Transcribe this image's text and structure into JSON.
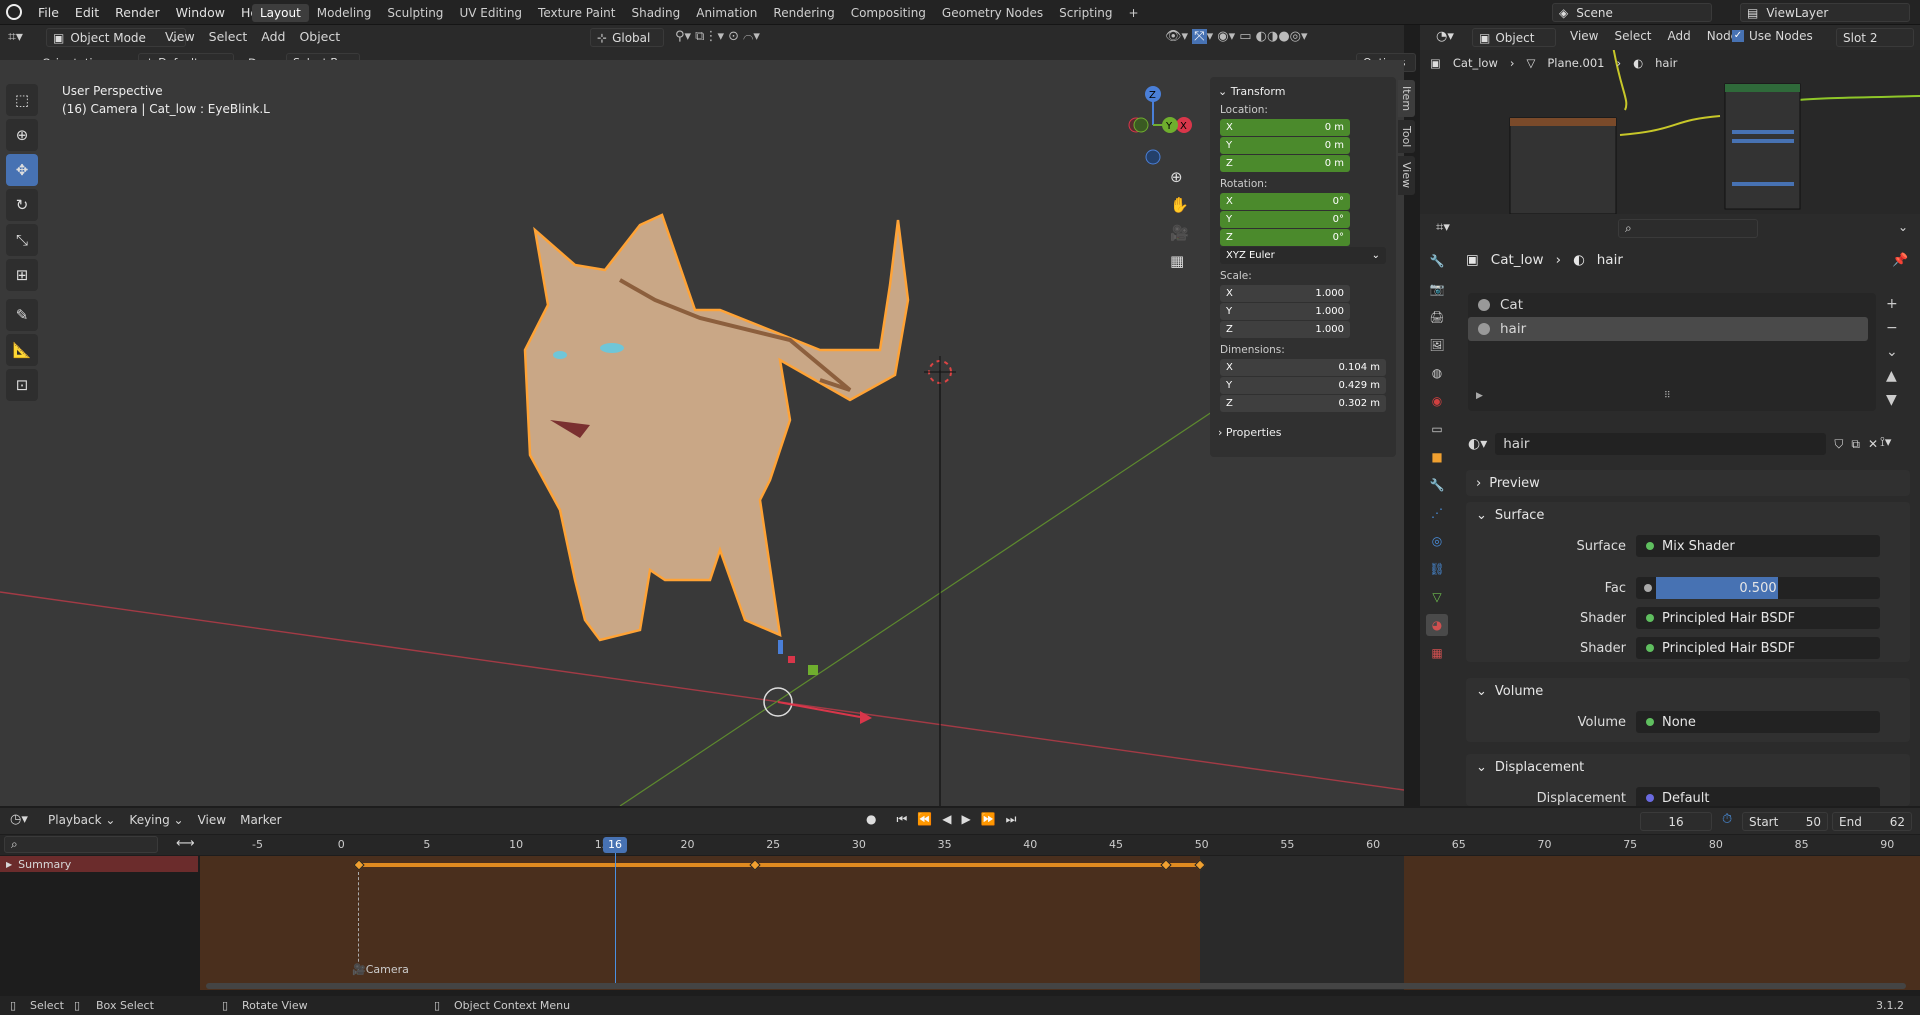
{
  "menubar": {
    "items": [
      "File",
      "Edit",
      "Render",
      "Window",
      "Help"
    ]
  },
  "workspaces": [
    "Layout",
    "Modeling",
    "Sculpting",
    "UV Editing",
    "Texture Paint",
    "Shading",
    "Animation",
    "Rendering",
    "Compositing",
    "Geometry Nodes",
    "Scripting",
    "+"
  ],
  "scene": {
    "label": "Scene",
    "viewlayer": "ViewLayer"
  },
  "viewport_header": {
    "mode": "Object Mode",
    "menus": [
      "View",
      "Select",
      "Add",
      "Object"
    ],
    "orientation_global": "Global",
    "options": "Options"
  },
  "tool_header": {
    "orientation_label": "Orientation:",
    "orientation_value": "Default",
    "drag_label": "Drag:",
    "drag_value": "Select Box"
  },
  "viewport": {
    "perspective": "User Perspective",
    "info": "(16) Camera | Cat_low : EyeBlink.L"
  },
  "toolbar_icons": [
    "select-box-icon",
    "cursor-icon",
    "move-icon",
    "rotate-icon",
    "scale-icon",
    "transform-icon",
    "annotate-icon",
    "measure-icon",
    "add-cube-icon"
  ],
  "npanel": {
    "title": "Transform",
    "location_label": "Location:",
    "location": [
      {
        "axis": "X",
        "value": "0 m"
      },
      {
        "axis": "Y",
        "value": "0 m"
      },
      {
        "axis": "Z",
        "value": "0 m"
      }
    ],
    "rotation_label": "Rotation:",
    "rotation": [
      {
        "axis": "X",
        "value": "0°"
      },
      {
        "axis": "Y",
        "value": "0°"
      },
      {
        "axis": "Z",
        "value": "0°"
      }
    ],
    "rotation_mode": "XYZ Euler",
    "scale_label": "Scale:",
    "scale": [
      {
        "axis": "X",
        "value": "1.000"
      },
      {
        "axis": "Y",
        "value": "1.000"
      },
      {
        "axis": "Z",
        "value": "1.000"
      }
    ],
    "dimensions_label": "Dimensions:",
    "dimensions": [
      {
        "axis": "X",
        "value": "0.104 m"
      },
      {
        "axis": "Y",
        "value": "0.429 m"
      },
      {
        "axis": "Z",
        "value": "0.302 m"
      }
    ],
    "properties": "Properties",
    "tabs": [
      "Item",
      "Tool",
      "View"
    ]
  },
  "node_header": {
    "mode": "Object",
    "menus": [
      "View",
      "Select",
      "Add",
      "Node"
    ],
    "use_nodes": "Use Nodes",
    "slot": "Slot 2",
    "breadcrumb": [
      "Cat_low",
      "Plane.001",
      "hair"
    ]
  },
  "properties": {
    "breadcrumb": [
      "Cat_low",
      "hair"
    ],
    "materials": [
      "Cat",
      "hair"
    ],
    "material_name": "hair",
    "preview": "Preview",
    "surface_section": "Surface",
    "surface_label": "Surface",
    "surface_value": "Mix Shader",
    "fac_label": "Fac",
    "fac_value": "0.500",
    "fac_fraction": 0.5,
    "shader_label": "Shader",
    "shader1": "Principled Hair BSDF",
    "shader2": "Principled Hair BSDF",
    "volume_section": "Volume",
    "volume_label": "Volume",
    "volume_value": "None",
    "displacement_section": "Displacement",
    "displacement_label": "Displacement",
    "displacement_value": "Default"
  },
  "timeline": {
    "menus": [
      "Playback",
      "Keying",
      "View",
      "Marker"
    ],
    "current": "16",
    "start_label": "Start",
    "start": "50",
    "end_label": "End",
    "end": "62",
    "ruler": [
      "-5",
      "0",
      "5",
      "10",
      "15",
      "20",
      "25",
      "30",
      "35",
      "40",
      "45",
      "50",
      "55",
      "60",
      "65",
      "70",
      "75",
      "80",
      "85",
      "90"
    ],
    "summary": "Summary",
    "marker": "Camera",
    "playhead": "16"
  },
  "statusbar": {
    "select": "Select",
    "box_select": "Box Select",
    "rotate": "Rotate View",
    "context": "Object Context Menu",
    "version": "3.1.2"
  }
}
